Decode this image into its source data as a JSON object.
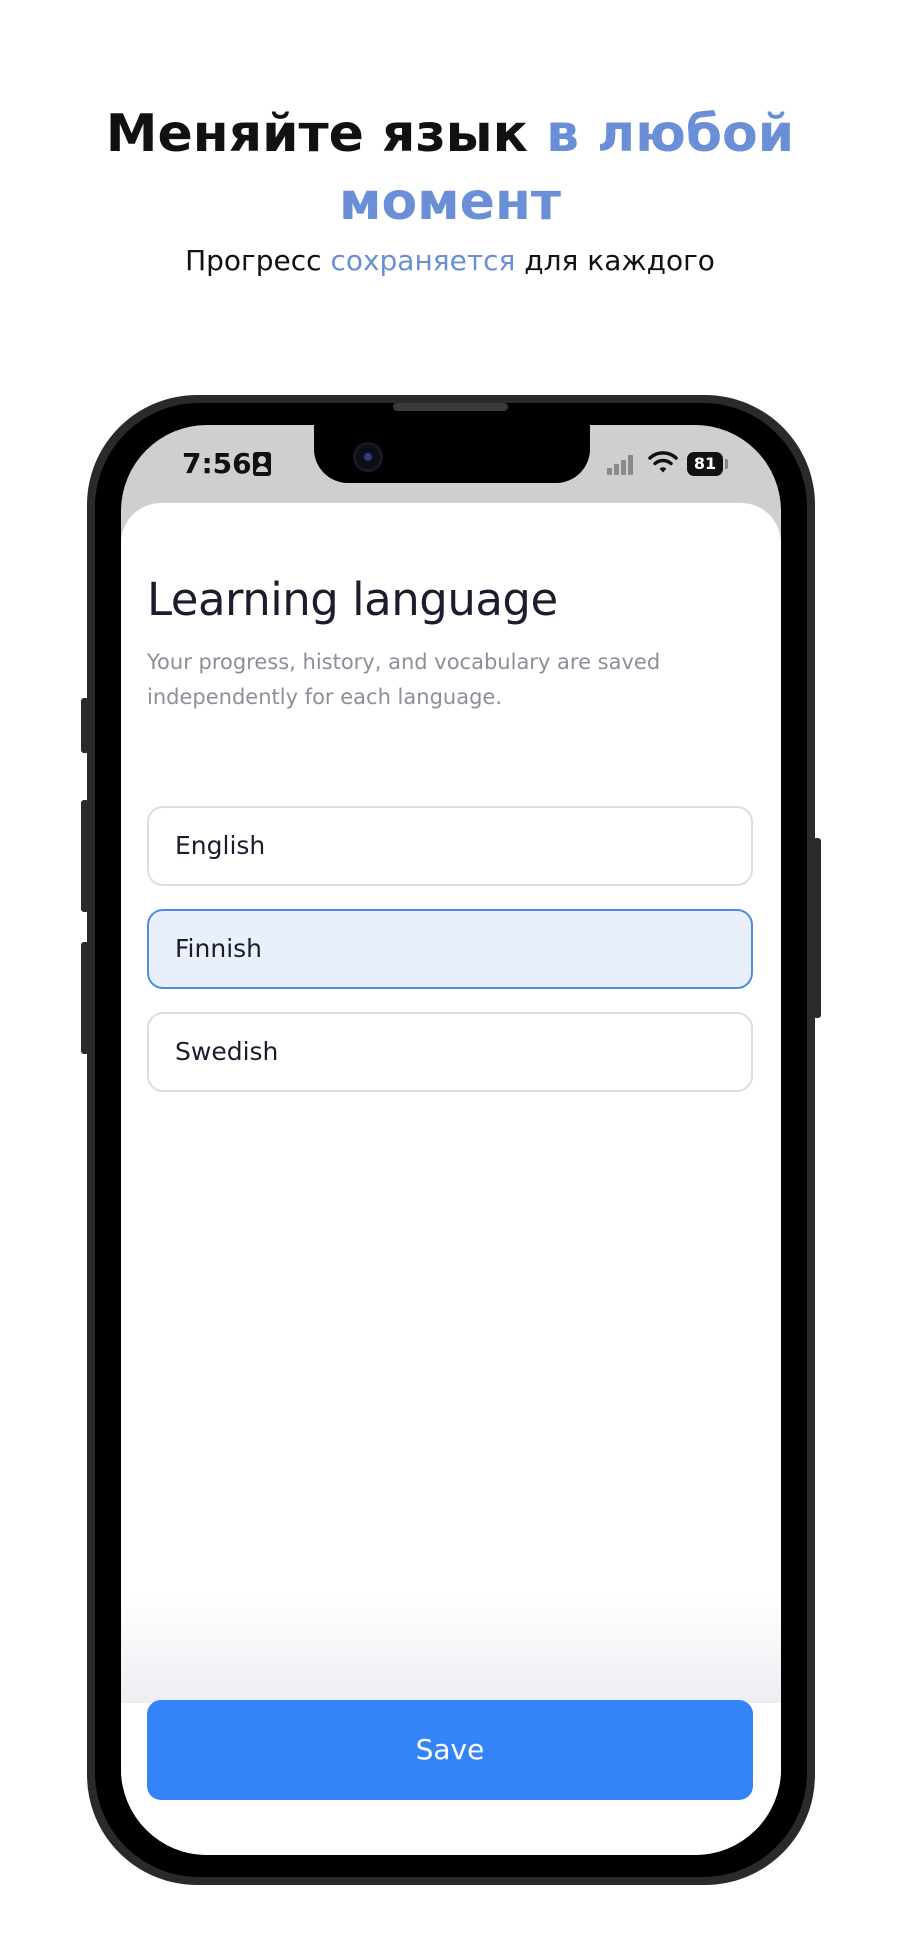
{
  "promo": {
    "headline_part1": "Меняйте язык ",
    "headline_accent": "в любой момент",
    "subline_part1": "Прогресс ",
    "subline_accent": "сохраняется",
    "subline_part2": " для каждого",
    "accent_color": "#6b8fd6"
  },
  "status_bar": {
    "time": "7:56",
    "battery": "81",
    "icons": [
      "id-card-icon",
      "signal-icon",
      "wifi-icon",
      "battery-icon"
    ]
  },
  "screen": {
    "title": "Learning language",
    "description": "Your progress, history, and vocabulary are saved independently for each language.",
    "options": [
      {
        "label": "English",
        "selected": false
      },
      {
        "label": "Finnish",
        "selected": true
      },
      {
        "label": "Swedish",
        "selected": false
      }
    ],
    "save_label": "Save",
    "primary_color": "#3583f8",
    "selected_bg": "#e9f0fc"
  }
}
